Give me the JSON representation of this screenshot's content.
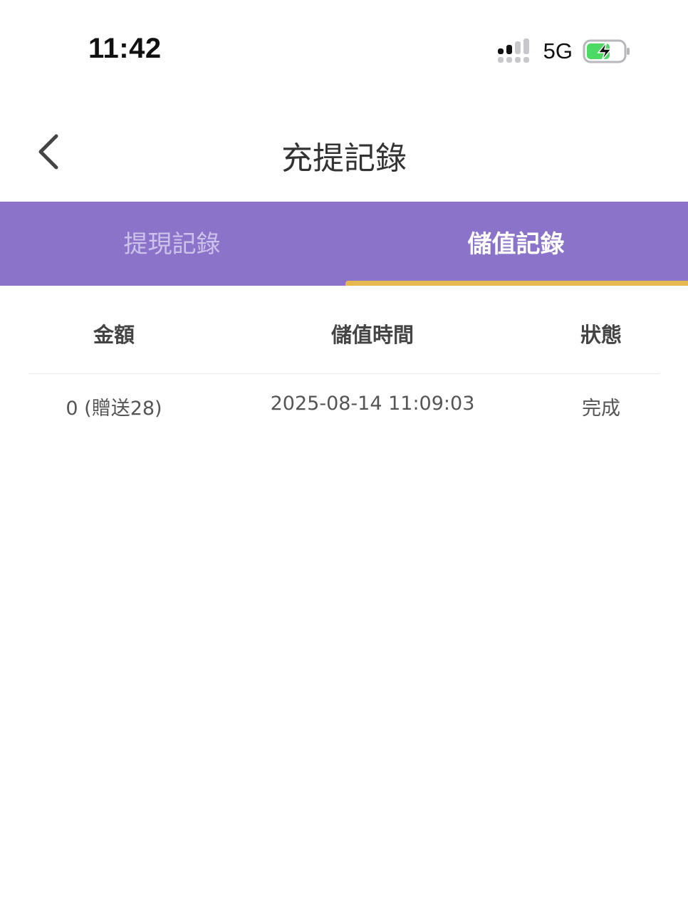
{
  "status_bar": {
    "time": "11:42",
    "network": "5G",
    "signal_icon": "signal-bars-icon",
    "battery_icon": "battery-charging-icon",
    "battery_color": "#4cd964"
  },
  "nav": {
    "back_icon": "chevron-left-icon",
    "title": "充提記錄"
  },
  "tabs": [
    {
      "label": "提現記錄",
      "active": false
    },
    {
      "label": "儲值記錄",
      "active": true
    }
  ],
  "colors": {
    "tab_bar": "#8a73c8",
    "tab_indicator": "#e6b84e"
  },
  "table": {
    "headers": [
      "金額",
      "儲值時間",
      "狀態"
    ],
    "rows": [
      {
        "amount": "0 (贈送28)",
        "time": "2025-08-14 11:09:03",
        "status": "完成"
      }
    ]
  }
}
